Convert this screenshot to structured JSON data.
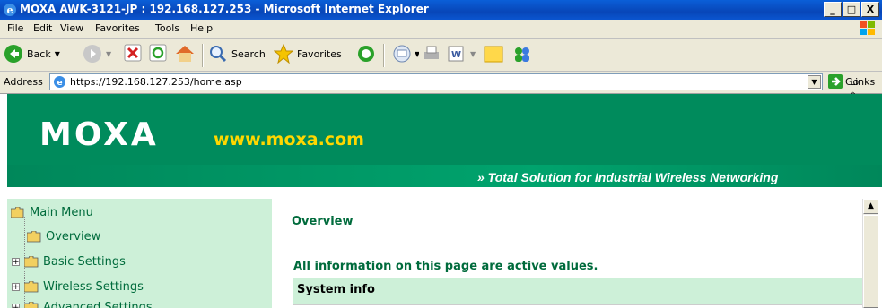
{
  "window": {
    "title": "MOXA AWK-3121-JP : 192.168.127.253 - Microsoft Internet Explorer",
    "controls": [
      "_",
      "□",
      "X"
    ]
  },
  "menu": [
    "File",
    "Edit",
    "View",
    "Favorites",
    "Tools",
    "Help"
  ],
  "toolbar": {
    "back": "Back",
    "search": "Search",
    "favorites": "Favorites"
  },
  "address": {
    "label": "Address",
    "url": "https://192.168.127.253/home.asp",
    "go": "Go",
    "links": "Links",
    "links_chevron": "»"
  },
  "banner": {
    "logo": "MOXA",
    "site": "www.moxa.com",
    "slogan": "» Total Solution for Industrial Wireless Networking"
  },
  "nav": {
    "root": "Main Menu",
    "items": [
      "Overview",
      "Basic Settings",
      "Wireless Settings",
      "Advanced Settings"
    ],
    "expander": "+"
  },
  "main": {
    "title": "Overview",
    "note": "All information on this page are active values.",
    "section": "System info"
  },
  "colors": {
    "brand_green": "#008b5c",
    "nav_bg": "#cdf0d8",
    "text_green": "#006b3c",
    "site_yellow": "#ffd700"
  }
}
